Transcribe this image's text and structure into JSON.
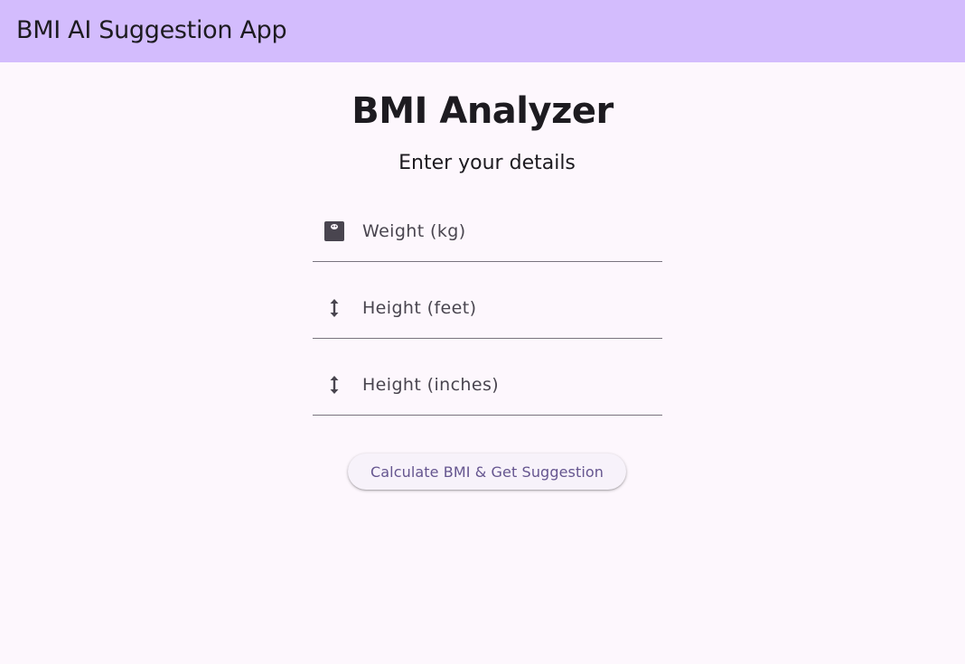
{
  "appbar": {
    "title": "BMI AI Suggestion App",
    "color": "#d3bcfd"
  },
  "main": {
    "title": "BMI Analyzer",
    "subtitle": "Enter your details"
  },
  "form": {
    "weight": {
      "placeholder": "Weight (kg)",
      "value": "",
      "icon": "scale-icon"
    },
    "height_feet": {
      "placeholder": "Height (feet)",
      "value": "",
      "icon": "height-icon"
    },
    "height_inches": {
      "placeholder": "Height (inches)",
      "value": "",
      "icon": "height-icon"
    }
  },
  "actions": {
    "calculate_label": "Calculate BMI & Get Suggestion",
    "accent": "#65558f"
  },
  "colors": {
    "background": "#fdf7fd",
    "text": "#1d1b20",
    "field_underline": "#79747e"
  }
}
